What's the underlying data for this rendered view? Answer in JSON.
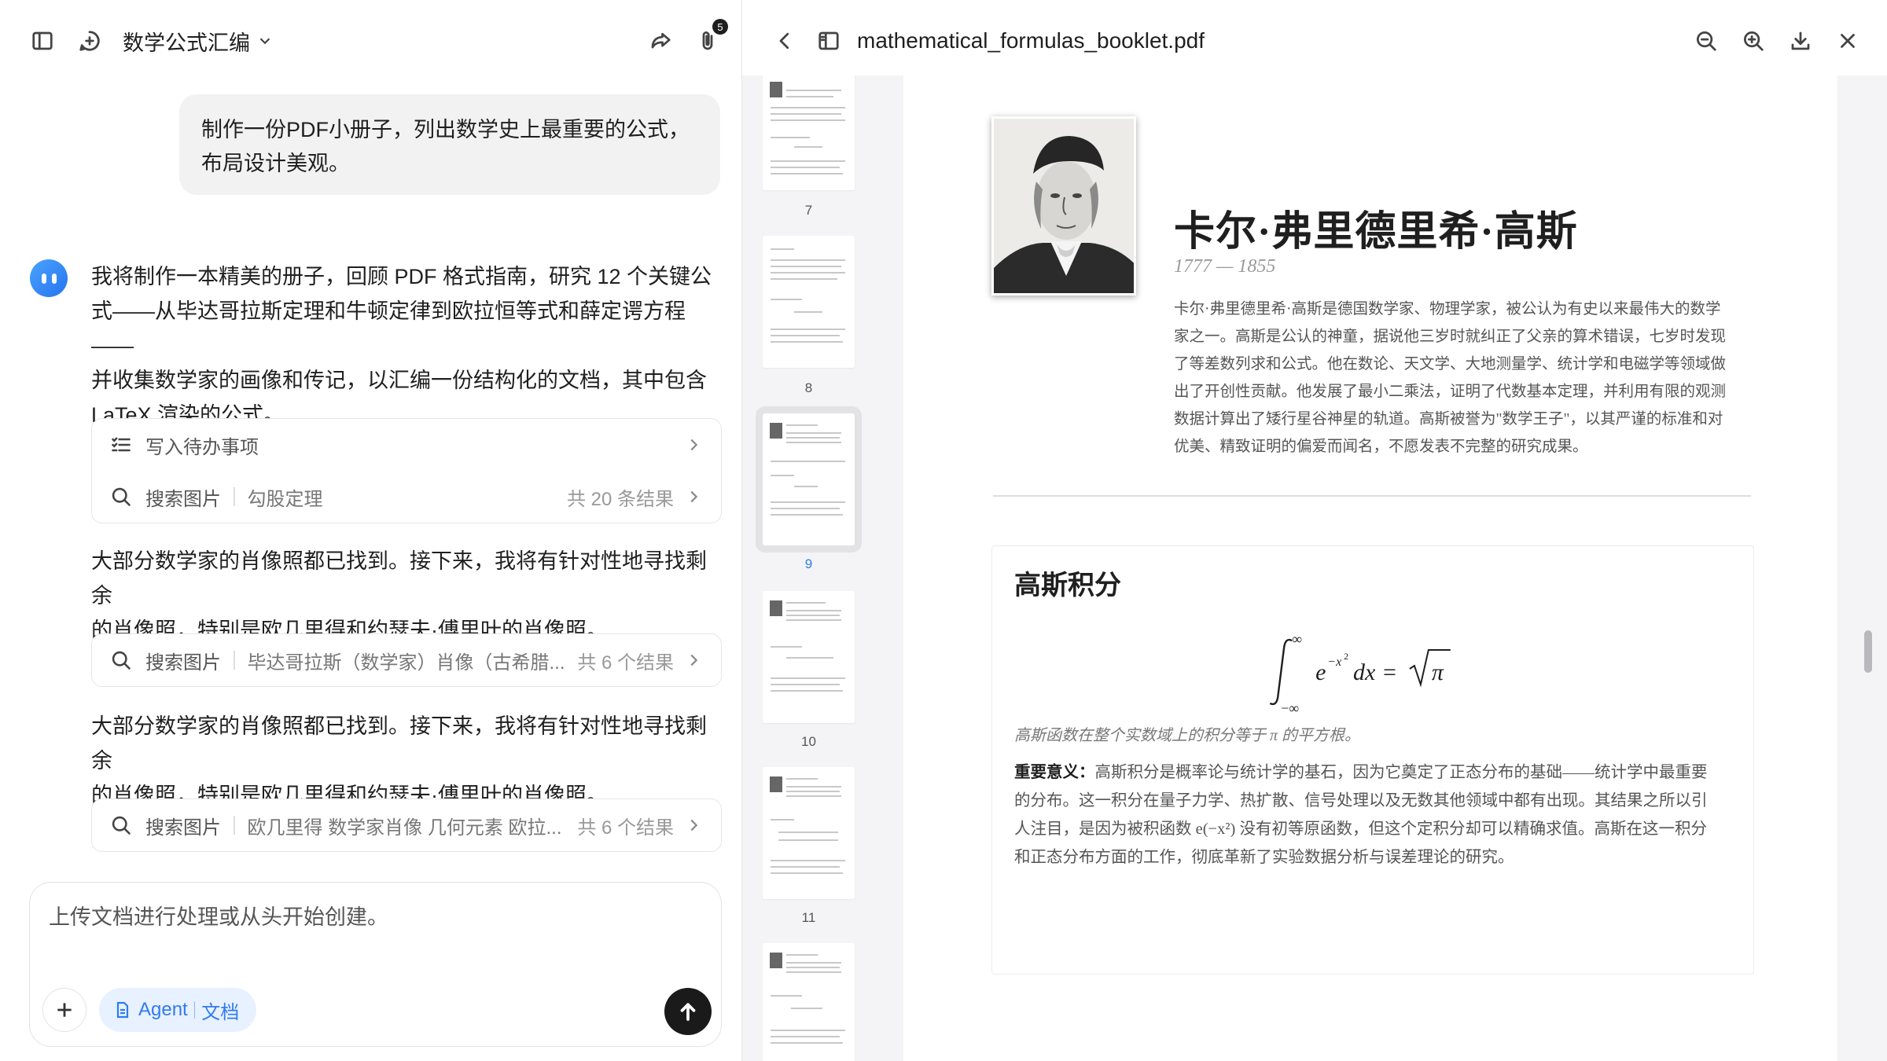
{
  "chat": {
    "title": "数学公式汇编",
    "attachment_count": "5",
    "user_message": {
      "line1": "制作一份PDF小册子，列出数学史上最重要的公式，",
      "line2": "布局设计美观。"
    },
    "assistant_message": {
      "line1": "我将制作一本精美的册子，回顾 PDF 格式指南，研究 12 个关键公",
      "line2": "式——从毕达哥拉斯定理和牛顿定律到欧拉恒等式和薛定谔方程——",
      "line3": "并收集数学家的画像和传记，以汇编一份结构化的文档，其中包含",
      "line4": "LaTeX 渲染的公式。"
    },
    "tool_card_1": {
      "todo_label": "写入待办事项",
      "search_label": "搜索图片",
      "search_query": "勾股定理",
      "search_count": "共 20 条结果"
    },
    "message_2": {
      "line1": "大部分数学家的肖像照都已找到。接下来，我将有针对性地寻找剩余",
      "line2": "的肖像照，特别是欧几里得和约瑟夫·傅里叶的肖像照。"
    },
    "tool_card_2": {
      "search_label": "搜索图片",
      "search_query": "毕达哥拉斯（数学家）肖像（古希腊...",
      "search_count": "共 6 个结果"
    },
    "message_3": {
      "line1": "大部分数学家的肖像照都已找到。接下来，我将有针对性地寻找剩余",
      "line2": "的肖像照，特别是欧几里得和约瑟夫·傅里叶的肖像照。"
    },
    "tool_card_3": {
      "search_label": "搜索图片",
      "search_query": "欧几里得 数学家肖像 几何元素 欧拉...",
      "search_count": "共 6 个结果"
    },
    "composer": {
      "placeholder": "上传文档进行处理或从头开始创建。",
      "agent_label": "Agent",
      "mode_label": "文档"
    }
  },
  "viewer": {
    "file_name": "mathematical_formulas_booklet.pdf",
    "thumbnails": [
      {
        "page": "7",
        "active": false
      },
      {
        "page": "8",
        "active": false
      },
      {
        "page": "9",
        "active": true
      },
      {
        "page": "10",
        "active": false
      },
      {
        "page": "11",
        "active": false
      },
      {
        "page": "",
        "active": false
      }
    ],
    "page": {
      "name": "卡尔·弗里德里希·高斯",
      "years": "1777 — 1855",
      "bio": [
        "卡尔·弗里德里希·高斯是德国数学家、物理学家，被公认为有史以来最伟大的数学",
        "家之一。高斯是公认的神童，据说他三岁时就纠正了父亲的算术错误，七岁时发现",
        "了等差数列求和公式。他在数论、天文学、大地测量学、统计学和电磁学等领域做",
        "出了开创性贡献。他发展了最小二乘法，证明了代数基本定理，并利用有限的观测",
        "数据计算出了矮行星谷神星的轨道。高斯被誉为\"数学王子\"，以其严谨的标准和对",
        "优美、精致证明的偏爱而闻名，不愿发表不完整的研究成果。"
      ],
      "formula_title": "高斯积分",
      "formula_caption": "高斯函数在整个实数域上的积分等于 π 的平方根。",
      "significance_label": "重要意义：",
      "significance": [
        "高斯积分是概率论与统计学的基石，因为它奠定了正态分布的基础——统计学中最重要",
        "的分布。这一积分在量子力学、热扩散、信号处理以及无数其他领域中都有出现。其结果之所以引",
        "人注目，是因为被积函数 e(−x²) 没有初等原函数，但这个定积分却可以精确求值。高斯在这一积分",
        "和正态分布方面的工作，彻底革新了实验数据分析与误差理论的研究。"
      ]
    }
  }
}
